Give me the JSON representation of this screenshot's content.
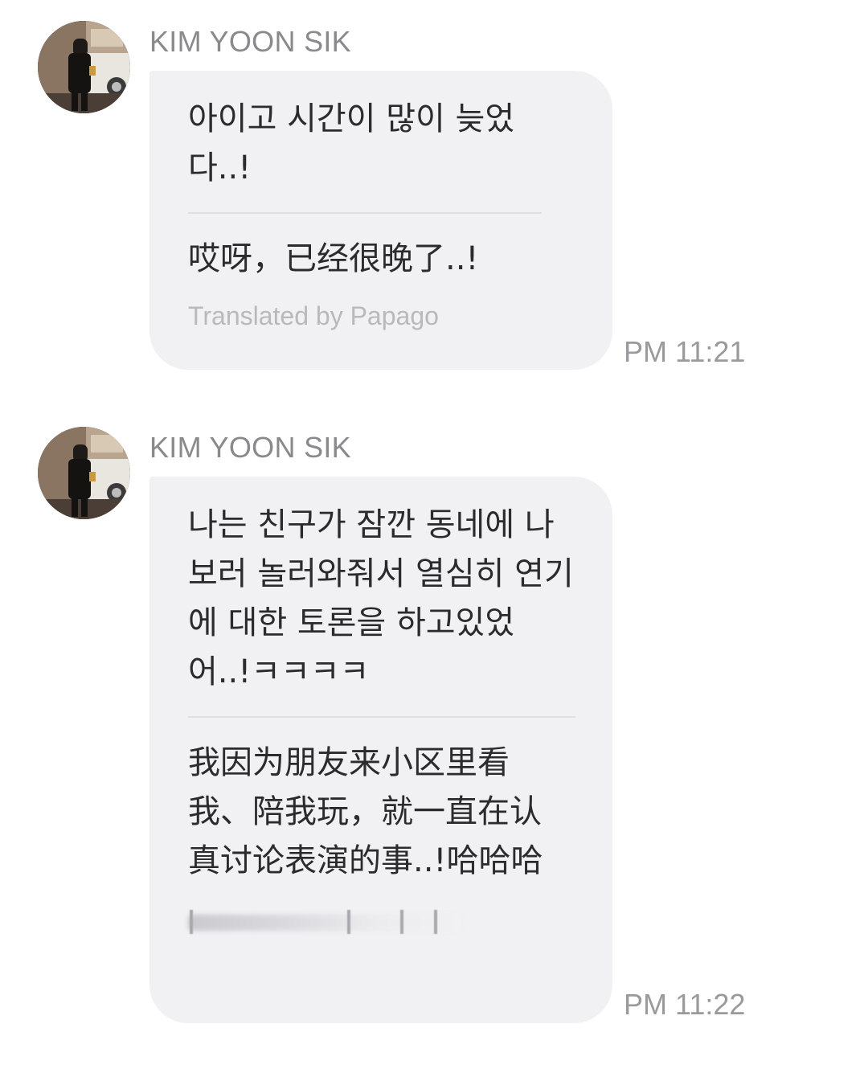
{
  "messages": [
    {
      "sender": "KIM YOON SIK",
      "original": "아이고 시간이 많이 늦었다..!",
      "translation": "哎呀，已经很晚了..!",
      "translated_by": "Translated by Papago",
      "time": "PM 11:21"
    },
    {
      "sender": "KIM YOON SIK",
      "original": "나는 친구가 잠깐 동네에 나 보러 놀러와줘서 열심히 연기에 대한 토론을 하고있었어..!ㅋㅋㅋㅋ",
      "translation": "我因为朋友来小区里看我、陪我玩，就一直在认真讨论表演的事..!哈哈哈",
      "time": "PM 11:22"
    }
  ],
  "colors": {
    "bubble": "#f1f1f3",
    "sender": "#8a8a8d",
    "timestamp": "#9a9a9e",
    "text": "#2b2b2b"
  }
}
